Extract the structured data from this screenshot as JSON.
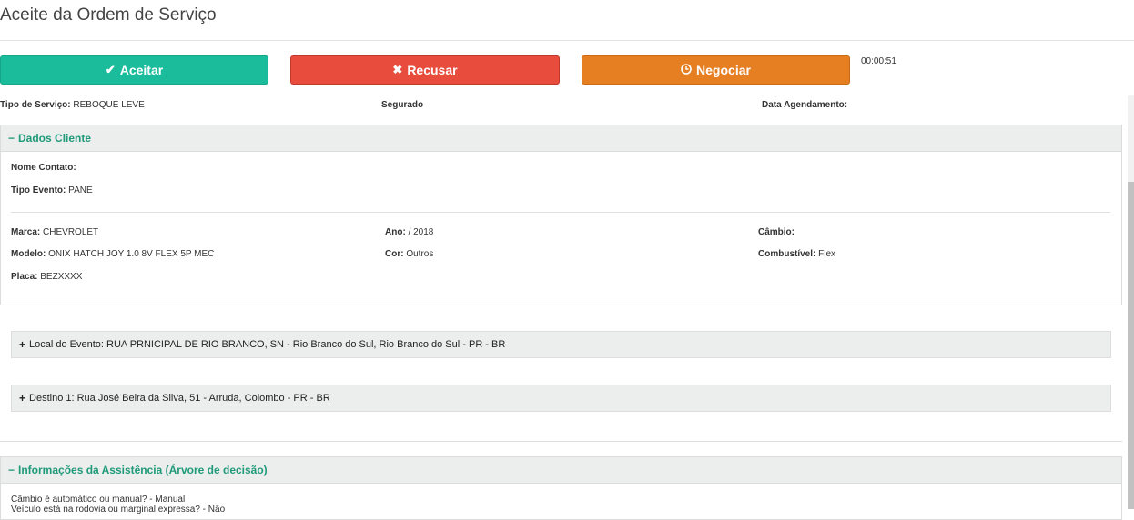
{
  "page": {
    "title": "Aceite da Ordem de Serviço"
  },
  "actions": {
    "accept_label": "Aceitar",
    "refuse_label": "Recusar",
    "negotiate_label": "Negociar",
    "timer": "00:00:51"
  },
  "summary": {
    "service_type_label": "Tipo de Serviço:",
    "service_type_value": "REBOQUE LEVE",
    "insured_label": "Segurado",
    "schedule_label": "Data Agendamento:"
  },
  "client": {
    "header": "Dados Cliente",
    "contact_label": "Nome Contato:",
    "event_type_label": "Tipo Evento:",
    "event_type_value": "PANE",
    "brand_label": "Marca:",
    "brand_value": "CHEVROLET",
    "year_label": "Ano:",
    "year_value": "/ 2018",
    "transmission_label": "Câmbio:",
    "model_label": "Modelo:",
    "model_value": "ONIX HATCH JOY 1.0 8V FLEX 5P MEC",
    "color_label": "Cor:",
    "color_value": "Outros",
    "fuel_label": "Combustível:",
    "fuel_value": "Flex",
    "plate_label": "Placa:",
    "plate_value": "BEZXXXX"
  },
  "location": {
    "text": "Local do Evento: RUA PRNICIPAL DE RIO BRANCO, SN - Rio Branco do Sul, Rio Branco do Sul - PR - BR"
  },
  "destination": {
    "text": "Destino 1: Rua José Beira da Silva, 51 - Arruda, Colombo - PR - BR"
  },
  "assistance": {
    "header": "Informações da Assistência (Árvore de decisão)",
    "lines": [
      "Câmbio é automático ou manual? - Manual",
      "Veículo está na rodovia ou marginal expressa? - Não"
    ]
  },
  "colors": {
    "accept": "#1abc9c",
    "refuse": "#e74c3c",
    "negotiate": "#e67e22",
    "panel_title": "#1f9a78"
  }
}
